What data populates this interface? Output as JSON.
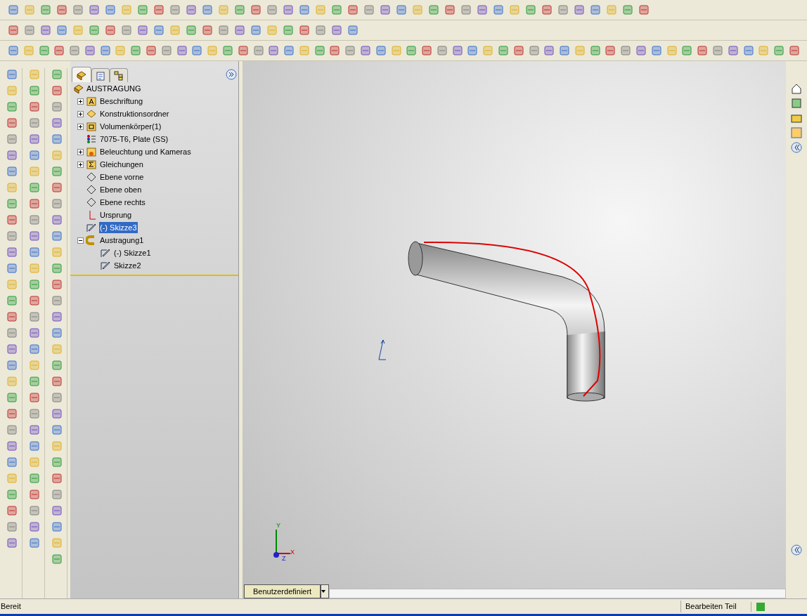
{
  "tree": {
    "root": "AUSTRAGUNG",
    "items": [
      {
        "label": "Beschriftung",
        "kind": "annotation",
        "expanded": false,
        "selected": false
      },
      {
        "label": "Konstruktionsordner",
        "kind": "design",
        "expanded": false,
        "selected": false
      },
      {
        "label": "Volumenkörper(1)",
        "kind": "solid",
        "expanded": false,
        "selected": false
      },
      {
        "label": "7075-T6, Plate (SS)",
        "kind": "material",
        "selected": false
      },
      {
        "label": "Beleuchtung und Kameras",
        "kind": "lights",
        "expanded": false,
        "selected": false
      },
      {
        "label": "Gleichungen",
        "kind": "equations",
        "expanded": false,
        "selected": false
      },
      {
        "label": "Ebene vorne",
        "kind": "plane",
        "selected": false
      },
      {
        "label": "Ebene oben",
        "kind": "plane",
        "selected": false
      },
      {
        "label": "Ebene rechts",
        "kind": "plane",
        "selected": false
      },
      {
        "label": "Ursprung",
        "kind": "origin",
        "selected": false
      },
      {
        "label": "(-) Skizze3",
        "kind": "sketch",
        "selected": true
      },
      {
        "label": "Austragung1",
        "kind": "sweep",
        "expanded": true,
        "selected": false,
        "children": [
          {
            "label": "(-) Skizze1",
            "kind": "sketch",
            "selected": false
          },
          {
            "label": "Skizze2",
            "kind": "sketch",
            "selected": false
          }
        ]
      }
    ]
  },
  "viewport": {
    "triad": {
      "y": "Y",
      "x": "X",
      "z": "Z"
    },
    "view_tab": "Benutzerdefiniert"
  },
  "status_bar": {
    "left": "Bereit",
    "mode": "Bearbeiten Teil"
  }
}
